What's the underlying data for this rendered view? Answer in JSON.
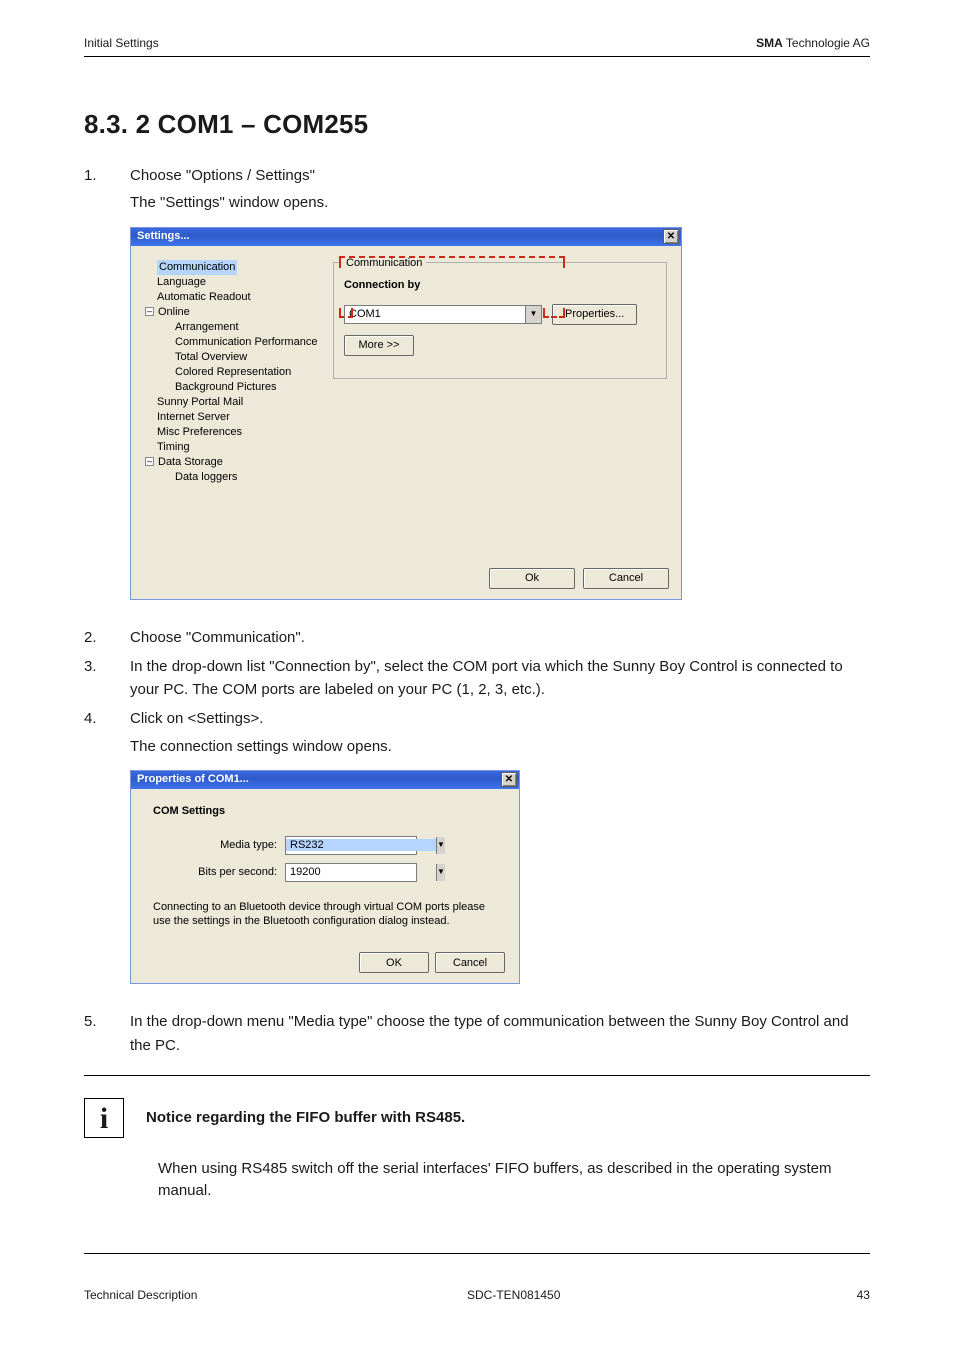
{
  "header": {
    "left": "Initial Settings",
    "right_bold": "SMA",
    "right_rest": " Technologie AG"
  },
  "section_title": "8.3. 2 COM1 – COM255",
  "steps": {
    "s1": {
      "num": "1.",
      "text": "Choose \"Options / Settings\"",
      "follow": "The \"Settings\" window opens."
    },
    "s2": {
      "num": "2.",
      "text": "Choose \"Communication\"."
    },
    "s3": {
      "num": "3.",
      "text": "In the drop-down list \"Connection by\", select the COM port via which the Sunny Boy Control is connected to your PC. The COM ports are labeled on your PC (1, 2, 3, etc.)."
    },
    "s4": {
      "num": "4.",
      "text": "Click on <Settings>.",
      "follow": "The connection settings window opens."
    },
    "s5": {
      "num": "5.",
      "text": "In the drop-down menu \"Media type\" choose the type of communication between the Sunny Boy Control and the PC."
    }
  },
  "win1": {
    "title": "Settings...",
    "tree": {
      "communication": "Communication",
      "language": "Language",
      "automatic_readout": "Automatic Readout",
      "online": "Online",
      "arrangement": "Arrangement",
      "comm_perf": "Communication Performance",
      "total_overview": "Total Overview",
      "colored_rep": "Colored Representation",
      "bg_pics": "Background Pictures",
      "sunny_portal": "Sunny Portal Mail",
      "internet_server": "Internet Server",
      "misc_prefs": "Misc Preferences",
      "timing": "Timing",
      "data_storage": "Data Storage",
      "data_loggers": "Data loggers"
    },
    "group_label": "Communication",
    "conn_by_label": "Connection by",
    "conn_by_value": "COM1",
    "properties_btn": "Properties...",
    "more_btn": "More >>",
    "ok": "Ok",
    "cancel": "Cancel"
  },
  "win2": {
    "title": "Properties of COM1...",
    "heading": "COM Settings",
    "media_type_label": "Media type:",
    "media_type_value": "RS232",
    "bits_label": "Bits per second:",
    "bits_value": "19200",
    "note": "Connecting to an Bluetooth device through virtual COM ports please use the settings in the Bluetooth configuration dialog instead.",
    "ok": "OK",
    "cancel": "Cancel"
  },
  "notice": {
    "title": "Notice regarding the FIFO buffer with RS485.",
    "body": "When using RS485 switch off the serial interfaces' FIFO buffers, as described in the operating system manual."
  },
  "footer": {
    "left": "Technical Description",
    "mid": "SDC-TEN081450",
    "page": "43"
  }
}
